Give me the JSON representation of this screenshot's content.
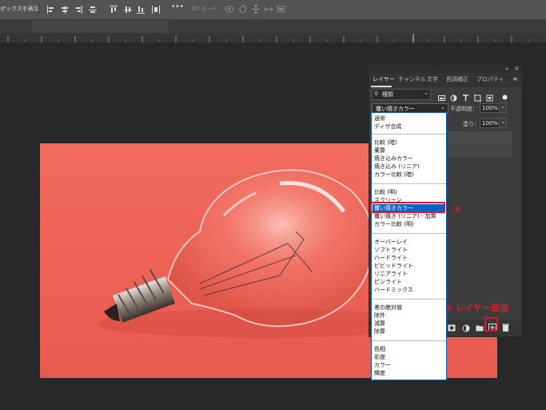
{
  "options_bar": {
    "show_transform_controls": "ボックスを表示",
    "more_label": "•••",
    "mode_3d_label": "3D モード："
  },
  "layers_panel": {
    "tabs": [
      "レイヤー",
      "チャンネル",
      "文字",
      "色調補正",
      "プロパティ"
    ],
    "active_tab": "レイヤー",
    "filter_label": "種類",
    "blend_mode_value": "覆い焼きカラー",
    "opacity_label": "不透明度：",
    "opacity_value": "100%",
    "fill_label": "塗り：",
    "fill_value": "100%"
  },
  "blend_dropdown": {
    "groups": [
      [
        "通常",
        "ディザ合成"
      ],
      [
        "比較 (暗)",
        "乗算",
        "焼き込みカラー",
        "焼き込み (リニア)",
        "カラー比較 (暗)"
      ],
      [
        "比較 (明)",
        "スクリーン",
        "覆い焼きカラー",
        "覆い焼き (リニア) - 加算",
        "カラー比較 (明)"
      ],
      [
        "オーバーレイ",
        "ソフトライト",
        "ハードライト",
        "ビビッドライト",
        "リニアライト",
        "ピンライト",
        "ハードミックス"
      ],
      [
        "差の絶対値",
        "除外",
        "減算",
        "除算"
      ],
      [
        "色相",
        "彩度",
        "カラー",
        "輝度"
      ]
    ],
    "selected": "覆い焼きカラー"
  },
  "annotations": {
    "step2": "②",
    "step1": "① レイヤー追加"
  },
  "colors": {
    "photo_background": "#ee6155",
    "highlight": "#0a63c8",
    "annotation_red": "#e31b2a"
  }
}
